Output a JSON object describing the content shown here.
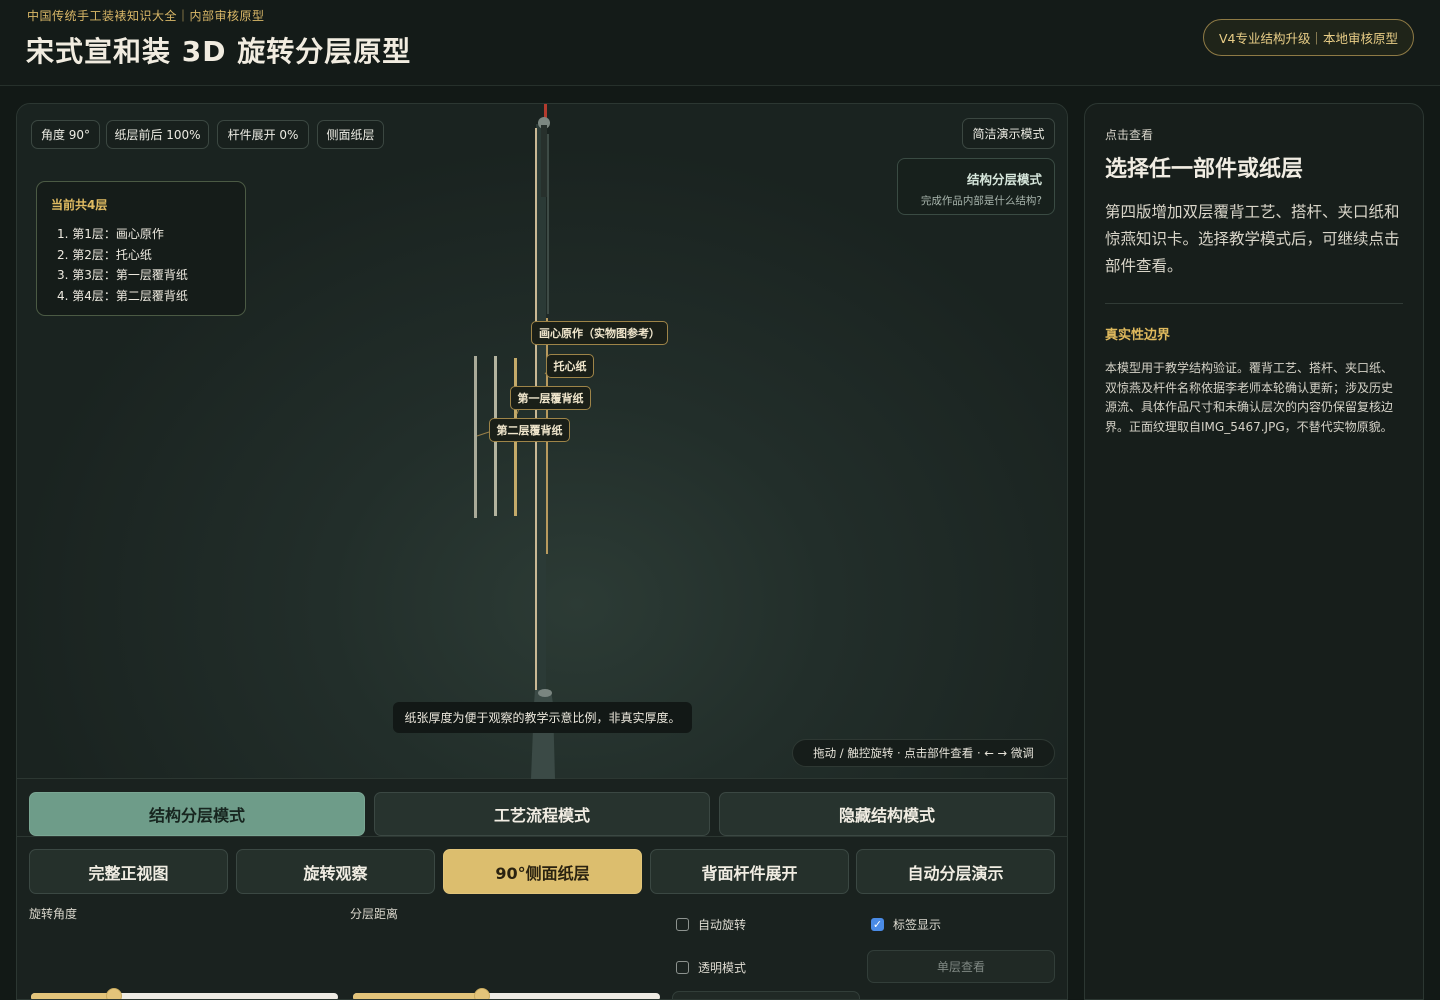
{
  "header": {
    "subtitle": "中国传统手工装裱知识大全｜内部审核原型",
    "title": "宋式宣和装 3D 旋转分层原型",
    "version_badge": "V4专业结构升级｜本地审核原型"
  },
  "stage": {
    "chips": {
      "angle": "角度 90°",
      "depth": "纸层前后 100%",
      "rod": "杆件展开 0%",
      "side": "侧面纸层",
      "simple_mode": "简洁演示模式"
    },
    "mode_card": {
      "title": "结构分层模式",
      "subtitle": "完成作品内部是什么结构?"
    },
    "layer_panel": {
      "title": "当前共4层",
      "items": [
        "1. 第1层：画心原作",
        "2. 第2层：托心纸",
        "3. 第3层：第一层覆背纸",
        "4. 第4层：第二层覆背纸"
      ]
    },
    "layer_labels": {
      "l1": "画心原作（实物图参考）",
      "l2": "托心纸",
      "l3": "第一层覆背纸",
      "l4": "第二层覆背纸"
    },
    "note": "纸张厚度为便于观察的教学示意比例，非真实厚度。",
    "hint": "拖动 / 触控旋转 · 点击部件查看 · ← → 微调"
  },
  "controls": {
    "modes": [
      "结构分层模式",
      "工艺流程模式",
      "隐藏结构模式"
    ],
    "views": [
      "完整正视图",
      "旋转观察",
      "90°侧面纸层",
      "背面杆件展开",
      "自动分层演示"
    ],
    "rotate_label": "旋转角度",
    "layer_distance_label": "分层距离",
    "rotate_value": 0.27,
    "distance_value": 0.42,
    "auto_rotate": "自动旋转",
    "show_labels": "标签显示",
    "transparent": "透明模式",
    "single_layer": "单层查看"
  },
  "info": {
    "small": "点击查看",
    "title": "选择任一部件或纸层",
    "desc": "第四版增加双层覆背工艺、搭杆、夹口纸和惊燕知识卡。选择教学模式后，可继续点击部件查看。",
    "section_title": "真实性边界",
    "section_body": "本模型用于教学结构验证。覆背工艺、搭杆、夹口纸、双惊燕及杆件名称依据李老师本轮确认更新；涉及历史源流、具体作品尺寸和未确认层次的内容仍保留复核边界。正面纹理取自IMG_5467.JPG，不替代实物原貌。"
  },
  "colors": {
    "accent_gold": "#dcbe6e",
    "accent_green": "#6e9c89",
    "background": "#121916"
  }
}
